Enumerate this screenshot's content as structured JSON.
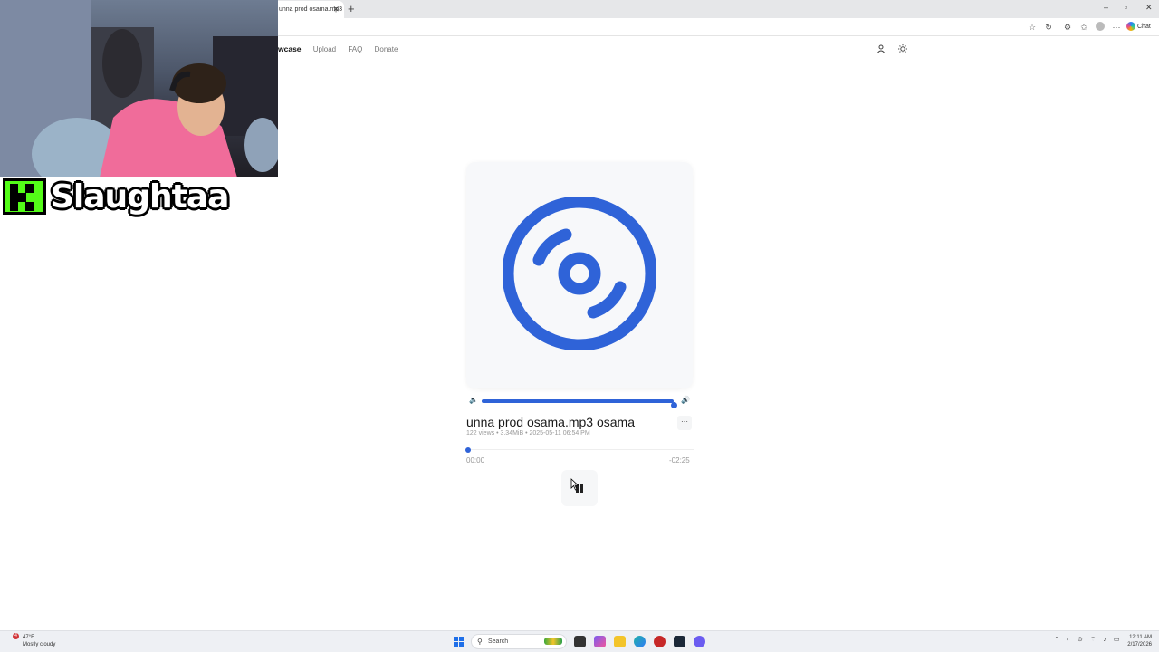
{
  "browser": {
    "tab_title": "unna prod osama.mp3",
    "tab_close": "✕",
    "new_tab": "+",
    "window_controls": [
      "–",
      "▫",
      "✕"
    ],
    "toolbar_icons": [
      "star-icon",
      "refresh-icon",
      "extensions-icon",
      "favorites-icon",
      "collections-icon",
      "profile-icon",
      "more-icon"
    ],
    "chat_label": "Chat"
  },
  "site": {
    "nav": {
      "brand": "wcase",
      "links": [
        "Upload",
        "FAQ",
        "Donate"
      ],
      "icons": [
        "user-icon",
        "theme-sun-icon"
      ]
    }
  },
  "player": {
    "title": "unna prod osama.mp3   osama",
    "meta": "122 views • 3.34MiB • 2025-05-11 06:54 PM",
    "time_elapsed": "00:00",
    "time_remaining": "-02:25",
    "volume_fraction": 1.0,
    "progress_fraction": 0.0,
    "more_label": "···",
    "state": "playing",
    "accent_color": "#2f63d8"
  },
  "overlay": {
    "streamer_name": "Slaughtaa",
    "platform_logo": "kick-logo",
    "platform_color": "#53fc18"
  },
  "taskbar": {
    "weather_temp": "47°F",
    "weather_desc": "Mostly cloudy",
    "weather_badge": "4",
    "search_label": "Search",
    "time": "12:11 AM",
    "date": "2/17/2026"
  }
}
